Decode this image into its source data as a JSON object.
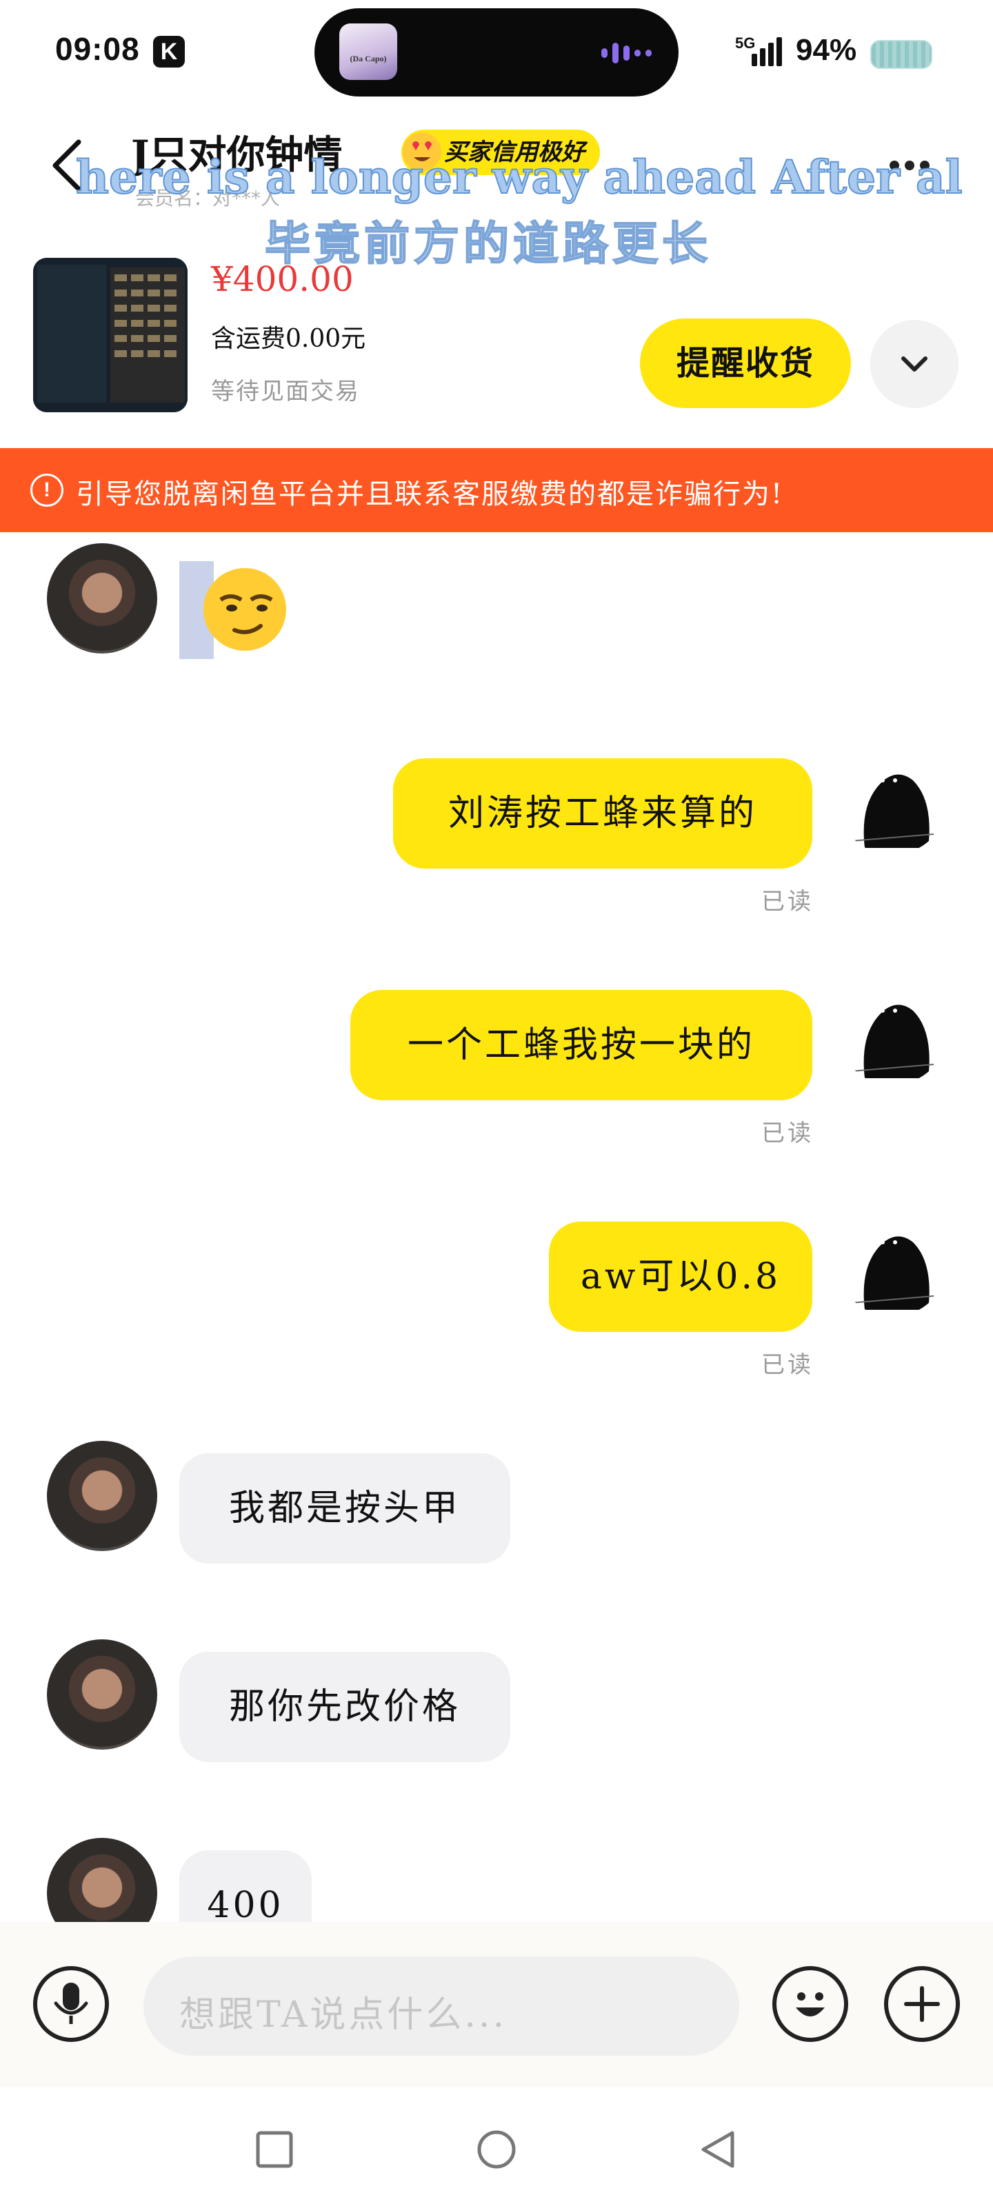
{
  "status_bar": {
    "time": "09:08",
    "app_badge": "K",
    "network": "5G",
    "battery": "94%",
    "island_art_text": "(Da Capo)"
  },
  "header": {
    "seller_name": "J只对你钟情",
    "credit_badge": "买家信用极好",
    "seller_sub": "会员名：对***人"
  },
  "subtitles": {
    "english": "here is a longer way ahead After al",
    "chinese": "毕竟前方的道路更长"
  },
  "product": {
    "price": "¥400.00",
    "shipping": "含运费0.00元",
    "status": "等待见面交易",
    "remind_button": "提醒收货"
  },
  "warning": {
    "text": "引导您脱离闲鱼平台并且联系客服缴费的都是诈骗行为!"
  },
  "messages": [
    {
      "side": "left",
      "type": "emoji"
    },
    {
      "side": "right",
      "text": "刘涛按工蜂来算的",
      "read": "已读"
    },
    {
      "side": "right",
      "text": "一个工蜂我按一块的",
      "read": "已读"
    },
    {
      "side": "right",
      "text": "aw可以0.8",
      "read": "已读"
    },
    {
      "side": "left",
      "text": "我都是按头甲"
    },
    {
      "side": "left",
      "text": "那你先改价格"
    },
    {
      "side": "left",
      "text": "400"
    }
  ],
  "input": {
    "placeholder": "想跟TA说点什么..."
  },
  "colors": {
    "accent_yellow": "#ffe60f",
    "warning_orange": "#ff5722",
    "price_red": "#e83a3a"
  }
}
